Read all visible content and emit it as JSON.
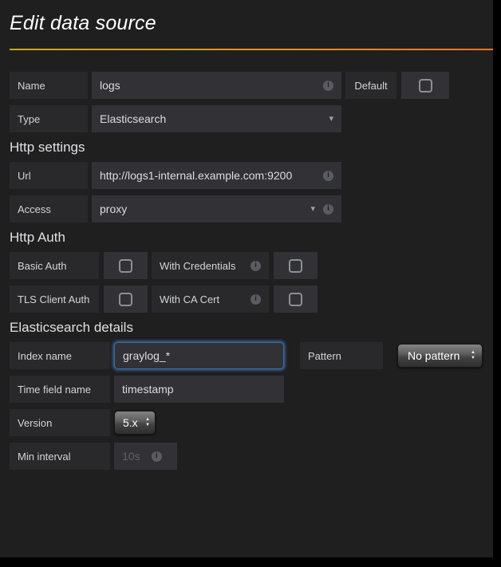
{
  "page": {
    "title": "Edit data source"
  },
  "colors": {
    "background": "#1f1f20",
    "label_bg": "#29292c",
    "input_bg": "#323236",
    "divider_gradient_start": "#cda81c",
    "divider_gradient_end": "#ef7126",
    "focus_glow": "#4888d6",
    "text": "#d3d4d6"
  },
  "icons": {
    "info": "i",
    "caret_down": "▾",
    "arrow_up": "▲",
    "arrow_down": "▼"
  },
  "top_form": {
    "name": {
      "label": "Name",
      "value": "logs"
    },
    "default": {
      "label": "Default",
      "checked": false
    },
    "type": {
      "label": "Type",
      "value": "Elasticsearch"
    }
  },
  "http_settings": {
    "heading": "Http settings",
    "url": {
      "label": "Url",
      "value": "http://logs1-internal.example.com:9200"
    },
    "access": {
      "label": "Access",
      "value": "proxy"
    }
  },
  "http_auth": {
    "heading": "Http Auth",
    "basic_auth": {
      "label": "Basic Auth",
      "checked": false
    },
    "with_credentials": {
      "label": "With Credentials",
      "checked": false
    },
    "tls_client_auth": {
      "label": "TLS Client Auth",
      "checked": false
    },
    "with_ca_cert": {
      "label": "With CA Cert",
      "checked": false
    }
  },
  "es_details": {
    "heading": "Elasticsearch details",
    "index_name": {
      "label": "Index name",
      "value": "graylog_*",
      "focused": true
    },
    "pattern": {
      "label": "Pattern",
      "value": "No pattern"
    },
    "time_field": {
      "label": "Time field name",
      "value": "timestamp"
    },
    "version": {
      "label": "Version",
      "value": "5.x"
    },
    "min_interval": {
      "label": "Min interval",
      "placeholder": "10s"
    }
  }
}
